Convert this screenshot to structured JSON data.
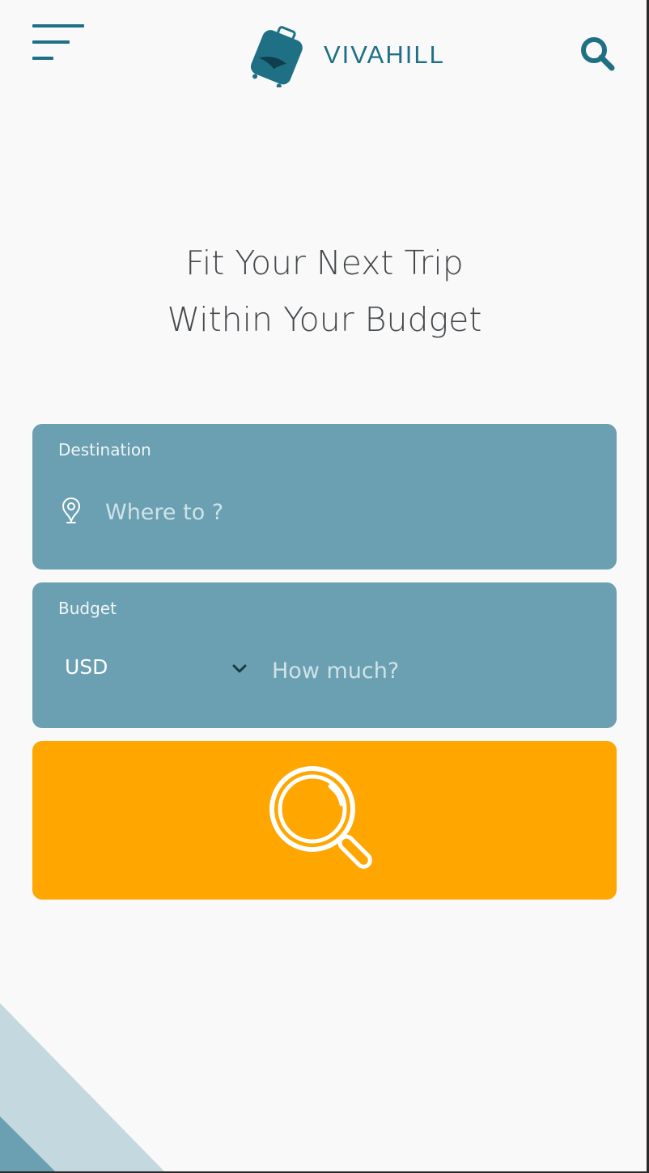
{
  "header": {
    "menu_icon": "hamburger-menu-icon",
    "logo_icon": "suitcase-icon",
    "brand": "VIVAHILL",
    "search_icon": "search-icon"
  },
  "hero": {
    "line1": "Fit Your Next Trip",
    "line2": "Within Your Budget"
  },
  "destination": {
    "label": "Destination",
    "icon": "map-pin-icon",
    "placeholder": "Where to ?"
  },
  "budget": {
    "label": "Budget",
    "currency": "USD",
    "currency_icon": "chevron-down-icon",
    "placeholder": "How much?"
  },
  "search_button": {
    "icon": "magnifier-icon"
  },
  "colors": {
    "brand": "#1f7085",
    "card": "#6aa0b1",
    "accent": "#ffa601",
    "background": "#f9f9fa"
  }
}
